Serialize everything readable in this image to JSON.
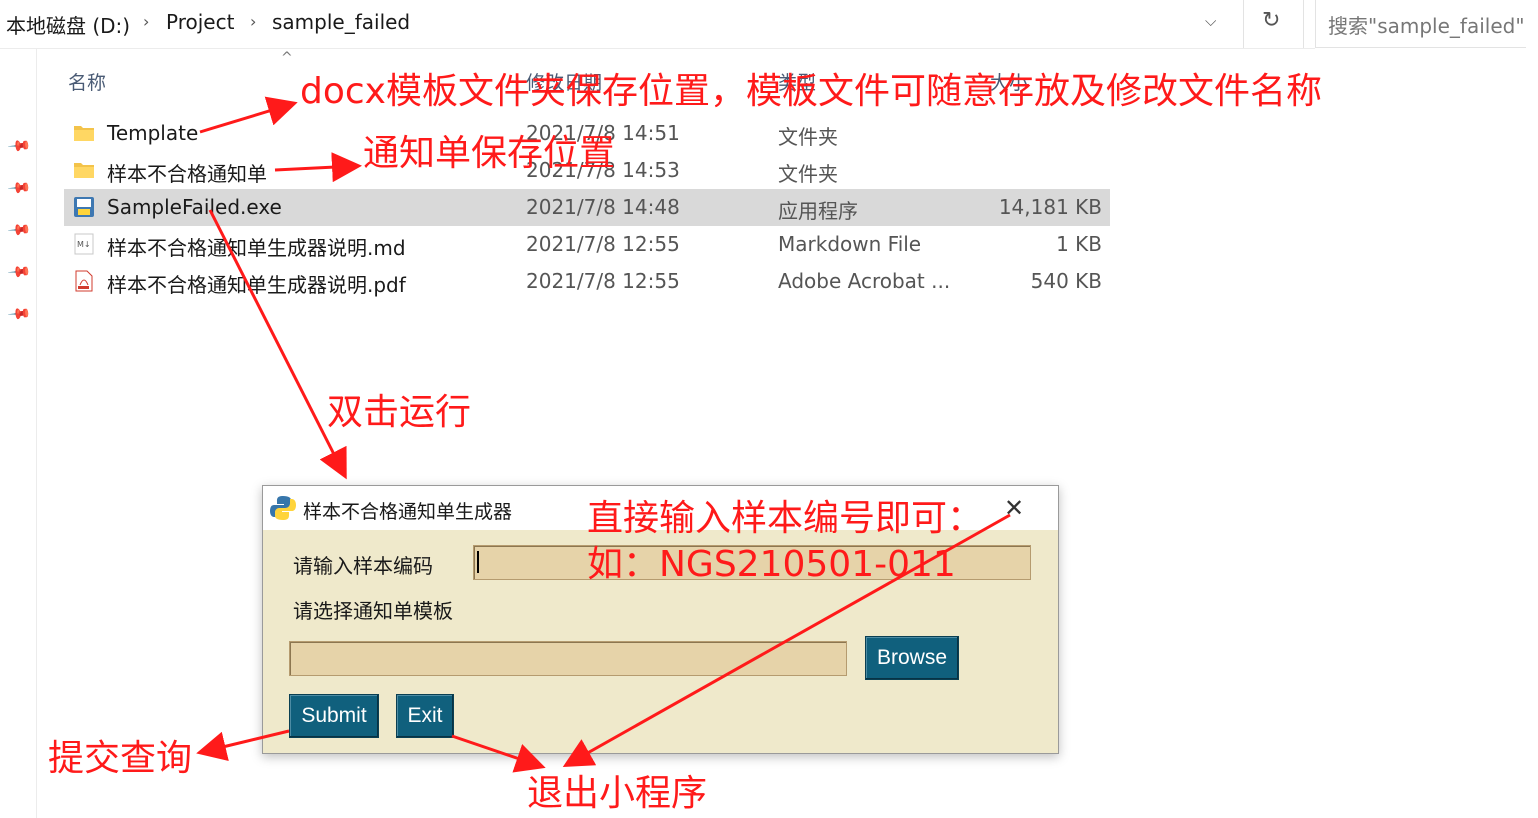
{
  "breadcrumb": {
    "items": [
      "本地磁盘 (D:)",
      "Project",
      "sample_failed"
    ]
  },
  "search": {
    "placeholder": "搜索\"sample_failed\""
  },
  "columns": {
    "name": "名称",
    "date": "修改日期",
    "type": "类型",
    "size": "大小"
  },
  "files": [
    {
      "name": "Template",
      "date": "2021/7/8 14:51",
      "type": "文件夹",
      "size": "",
      "icon": "folder-icon"
    },
    {
      "name": "样本不合格通知单",
      "date": "2021/7/8 14:53",
      "type": "文件夹",
      "size": "",
      "icon": "folder-icon"
    },
    {
      "name": "SampleFailed.exe",
      "date": "2021/7/8 14:48",
      "type": "应用程序",
      "size": "14,181 KB",
      "icon": "python-exe-icon"
    },
    {
      "name": "样本不合格通知单生成器说明.md",
      "date": "2021/7/8 12:55",
      "type": "Markdown File",
      "size": "1 KB",
      "icon": "markdown-icon"
    },
    {
      "name": "样本不合格通知单生成器说明.pdf",
      "date": "2021/7/8 12:55",
      "type": "Adobe Acrobat ...",
      "size": "540 KB",
      "icon": "pdf-icon"
    }
  ],
  "app": {
    "title": "样本不合格通知单生成器",
    "sample_label": "请输入样本编码",
    "template_label": "请选择通知单模板",
    "browse_label": "Browse",
    "submit_label": "Submit",
    "exit_label": "Exit"
  },
  "annotations": {
    "template_note": "docx模板文件夹保存位置，模板文件可随意存放及修改文件名称",
    "notice_folder_note": "通知单保存位置",
    "double_click_note": "双击运行",
    "input_note_line1": "直接输入样本编号即可：",
    "input_note_line2": "如：NGS210501-011",
    "submit_note": "提交查询",
    "exit_note": "退出小程序"
  },
  "colors": {
    "annotation": "#ff1a1a",
    "app_background": "#efe9cb",
    "entry_background": "#e6d3a9",
    "button": "#10607d",
    "selected_row": "#d9d9d9"
  }
}
